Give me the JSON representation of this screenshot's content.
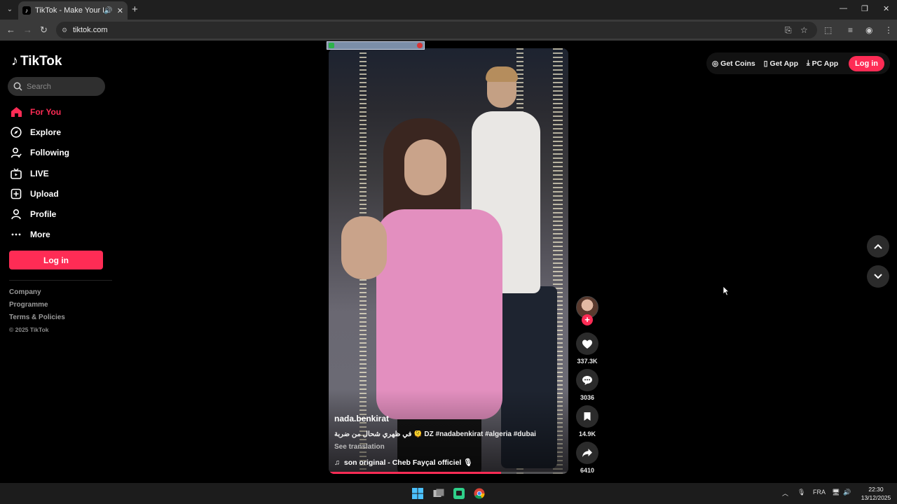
{
  "browser": {
    "tab_title": "TikTok - Make Your Day",
    "url": "tiktok.com"
  },
  "sidebar": {
    "logo": "TikTok",
    "search_placeholder": "Search",
    "nav": [
      {
        "label": "For You",
        "icon": "home-icon",
        "active": true
      },
      {
        "label": "Explore",
        "icon": "compass-icon",
        "active": false
      },
      {
        "label": "Following",
        "icon": "following-icon",
        "active": false
      },
      {
        "label": "LIVE",
        "icon": "live-icon",
        "active": false
      },
      {
        "label": "Upload",
        "icon": "upload-icon",
        "active": false
      },
      {
        "label": "Profile",
        "icon": "profile-icon",
        "active": false
      },
      {
        "label": "More",
        "icon": "more-icon",
        "active": false
      }
    ],
    "login_label": "Log in",
    "footer": {
      "company": "Company",
      "programme": "Programme",
      "terms": "Terms & Policies",
      "copyright": "© 2025 TikTok"
    }
  },
  "header": {
    "get_coins": "Get Coins",
    "get_app": "Get App",
    "pc_app": "PC App",
    "login": "Log in"
  },
  "video": {
    "author": "nada.benkirat",
    "caption": "في ظهري شحال من ضربة 🫠 DZ #nadabenkirat #algeria #dubai",
    "see_translation": "See translation",
    "sound": "son original - Cheb Fayçal officiel 🎙",
    "progress": 0.72
  },
  "actions": {
    "likes": "337.3K",
    "comments": "3036",
    "saves": "14.9K",
    "shares": "6410"
  },
  "taskbar": {
    "lang": "FRA",
    "time": "22:30",
    "date": "13/12/2025"
  },
  "colors": {
    "accent": "#fe2c55",
    "background": "#000000"
  }
}
